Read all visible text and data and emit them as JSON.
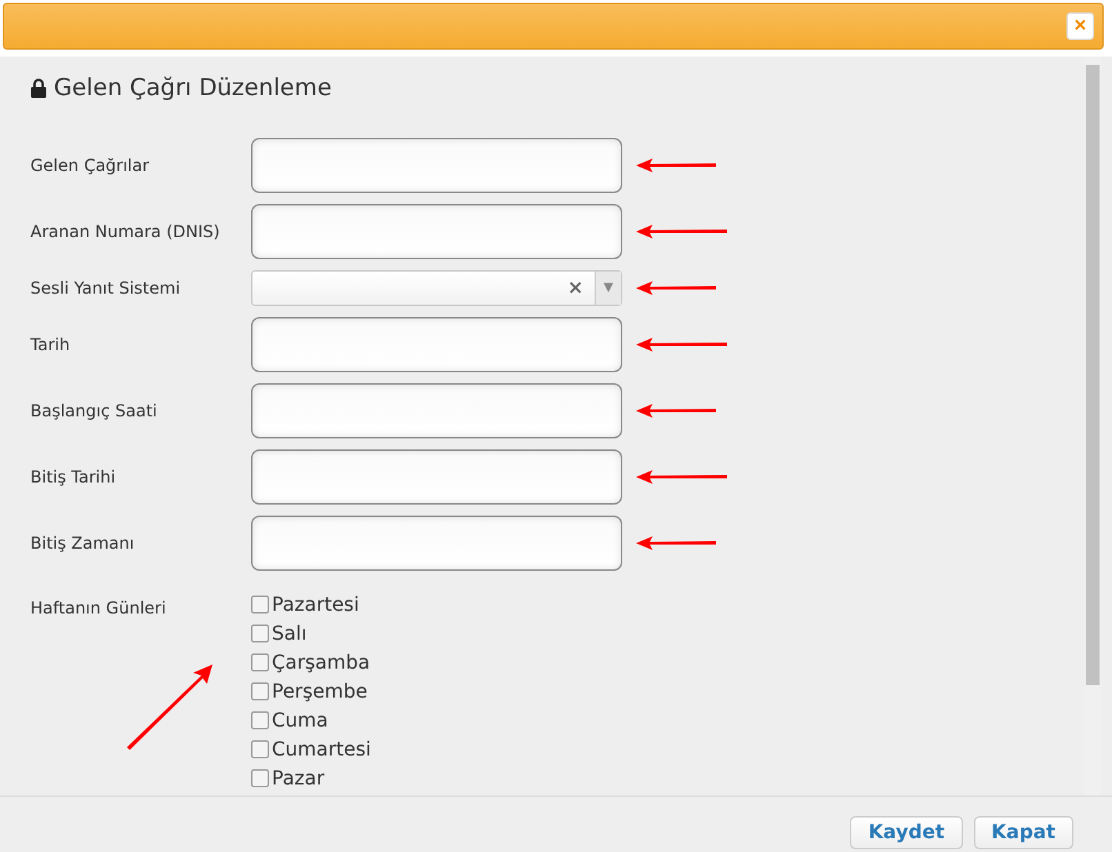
{
  "dialog": {
    "close_button": "×",
    "title": "Gelen Çağrı Düzenleme"
  },
  "fields": [
    {
      "label": "Gelen Çağrılar",
      "kind": "text"
    },
    {
      "label": "Aranan Numara (DNIS)",
      "kind": "text"
    },
    {
      "label": "Sesli Yanıt Sistemi",
      "kind": "select",
      "clear": "×",
      "caret": "▼"
    },
    {
      "label": "Tarih",
      "kind": "text"
    },
    {
      "label": "Başlangıç Saati",
      "kind": "text"
    },
    {
      "label": "Bitiş Tarihi",
      "kind": "text"
    },
    {
      "label": "Bitiş Zamanı",
      "kind": "text"
    }
  ],
  "weekdays": {
    "label": "Haftanın Günleri",
    "days": [
      {
        "label": "Pazartesi",
        "checked": false
      },
      {
        "label": "Salı",
        "checked": false
      },
      {
        "label": "Çarşamba",
        "checked": false
      },
      {
        "label": "Perşembe",
        "checked": false
      },
      {
        "label": "Cuma",
        "checked": false
      },
      {
        "label": "Cumartesi",
        "checked": false
      },
      {
        "label": "Pazar",
        "checked": false
      }
    ]
  },
  "buttons": [
    "Kaydet",
    "Kapat"
  ]
}
